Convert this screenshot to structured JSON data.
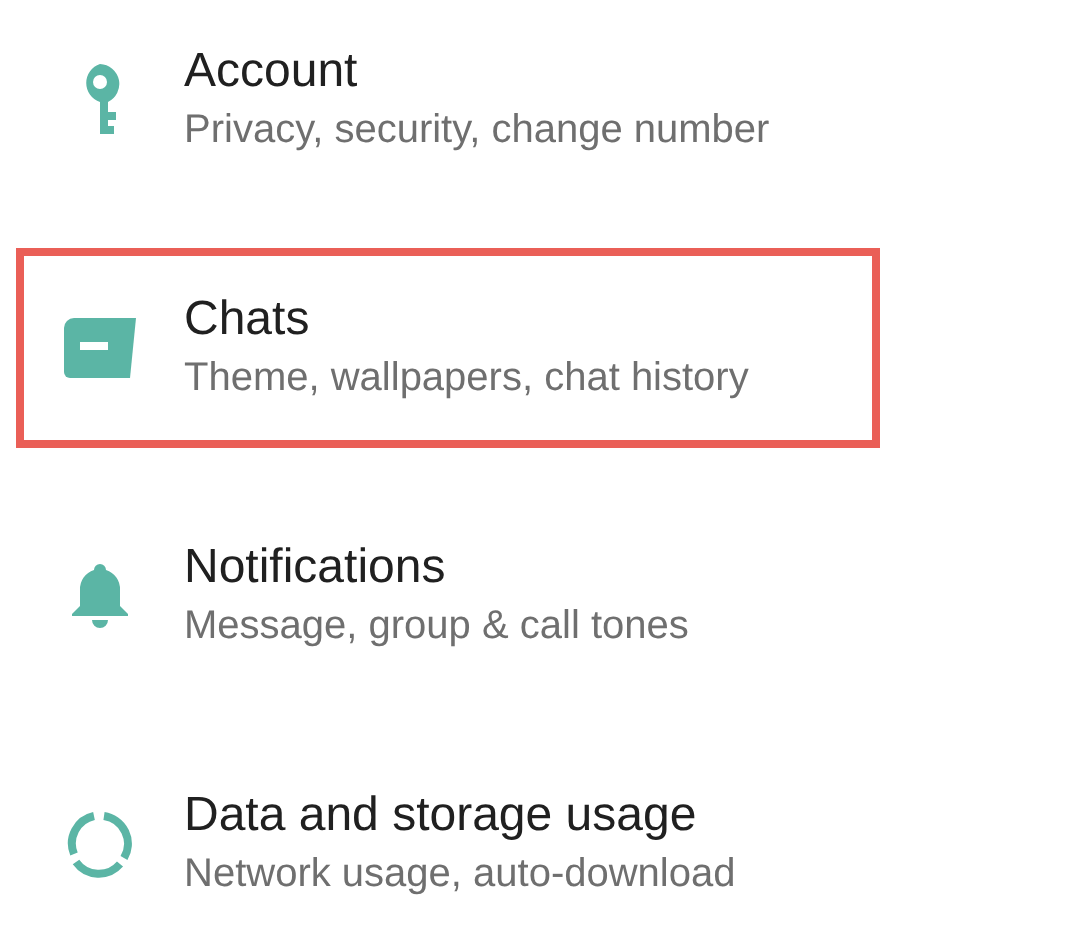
{
  "settings": [
    {
      "kind": "account",
      "title": "Account",
      "subtitle": "Privacy, security, change number",
      "highlighted": false
    },
    {
      "kind": "chats",
      "title": "Chats",
      "subtitle": "Theme, wallpapers, chat history",
      "highlighted": true
    },
    {
      "kind": "notifications",
      "title": "Notifications",
      "subtitle": "Message, group & call tones",
      "highlighted": false
    },
    {
      "kind": "data",
      "title": "Data and storage usage",
      "subtitle": "Network usage, auto-download",
      "highlighted": false
    }
  ]
}
